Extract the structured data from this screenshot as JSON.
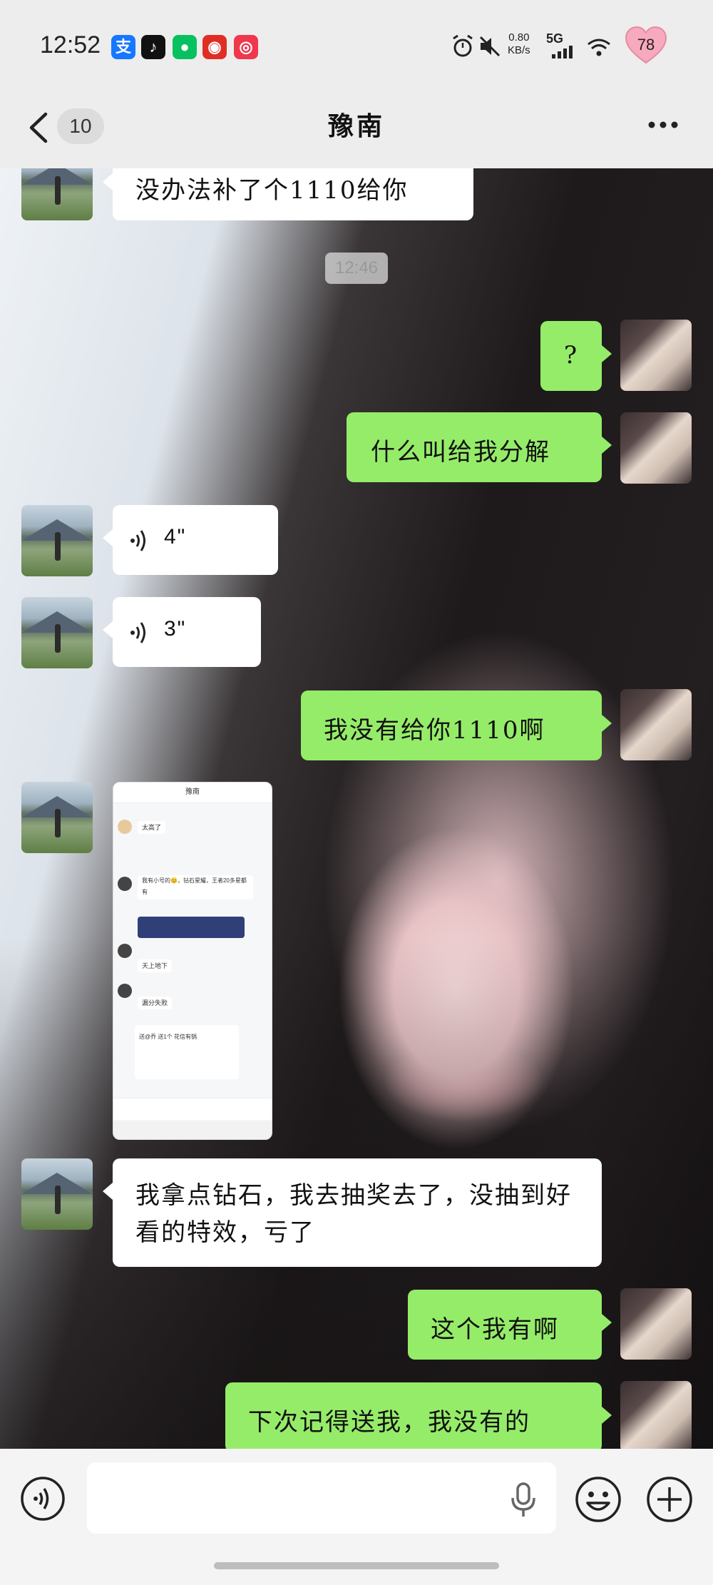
{
  "status_bar": {
    "time": "12:52",
    "apps": [
      {
        "name": "alipay-icon",
        "glyph": "支",
        "color": "#1677ff"
      },
      {
        "name": "tiktok-icon",
        "glyph": "♪",
        "color": "#111111"
      },
      {
        "name": "wechat-icon",
        "glyph": "●",
        "color": "#07c160"
      },
      {
        "name": "pinduoduo-icon",
        "glyph": "◉",
        "color": "#e02e24"
      },
      {
        "name": "app-red-icon",
        "glyph": "◎",
        "color": "#f0374d"
      }
    ],
    "net_speed": "0.80",
    "net_unit": "KB/s",
    "signal": "5G",
    "battery": "78"
  },
  "header": {
    "back_badge": "10",
    "title": "豫南"
  },
  "messages": [
    {
      "side": "in",
      "text": "没办法补了个1110给你"
    },
    {
      "type": "time",
      "text": "12:46"
    },
    {
      "side": "out",
      "text": "?"
    },
    {
      "side": "out",
      "text": "什么叫给我分解"
    },
    {
      "side": "in",
      "type": "voice",
      "duration": "4\""
    },
    {
      "side": "in",
      "type": "voice",
      "duration": "3\""
    },
    {
      "side": "out",
      "text": "我没有给你1110啊"
    },
    {
      "side": "in",
      "type": "image"
    },
    {
      "side": "in",
      "text": "我拿点钻石，我去抽奖去了，没抽到好看的特效，亏了"
    },
    {
      "side": "out",
      "text": "这个我有啊"
    },
    {
      "side": "out",
      "text": "下次记得送我，我没有的"
    }
  ],
  "screenshot": {
    "title": "豫南",
    "lines": [
      "太高了",
      "我有小号的😊，钻石星耀，王者20多星都有",
      "天上地下",
      "漏分失败",
      "送@乔 送1个 花信有锅"
    ]
  },
  "colors": {
    "outgoing_bubble": "#95ec69",
    "incoming_bubble": "#ffffff",
    "nav_background": "#ededed"
  }
}
